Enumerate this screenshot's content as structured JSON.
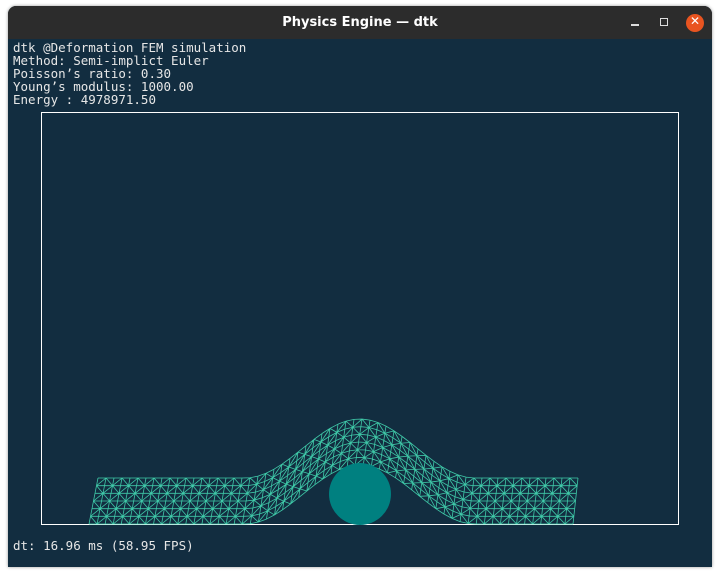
{
  "window": {
    "title": "Physics Engine — dtk"
  },
  "info": {
    "line1": "dtk @Deformation FEM simulation",
    "line2": "Method: Semi-implict Euler",
    "line3": "Poisson’s ratio: 0.30",
    "line4": "Young’s modulus: 1000.00",
    "line5": "Energy : 4978971.50"
  },
  "status": {
    "dt": "dt: 16.96 ms (58.95 FPS)"
  },
  "colors": {
    "background": "#122d40",
    "mesh": "#3fc9a8",
    "ball": "#008080",
    "close": "#e95420"
  }
}
